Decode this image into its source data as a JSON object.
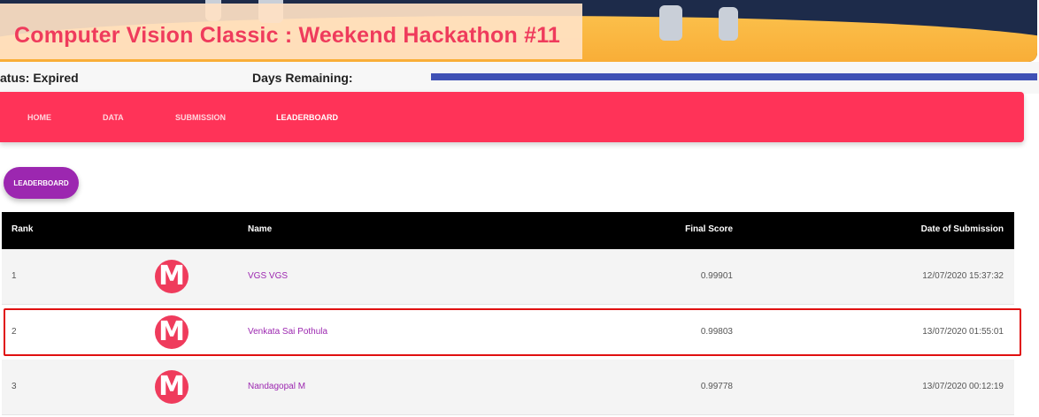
{
  "header": {
    "title": "Computer Vision Classic : Weekend Hackathon #11"
  },
  "status": {
    "status_text": "atus: Expired",
    "days_remaining_label": "Days Remaining:"
  },
  "nav": {
    "items": [
      {
        "label": "HOME"
      },
      {
        "label": "DATA"
      },
      {
        "label": "SUBMISSION"
      },
      {
        "label": "LEADERBOARD"
      }
    ],
    "active": "LEADERBOARD"
  },
  "leaderboard_button": "LEADERBOARD",
  "table": {
    "headers": {
      "rank": "Rank",
      "name": "Name",
      "score": "Final Score",
      "date": "Date of Submission"
    },
    "rows": [
      {
        "rank": "1",
        "avatar": "M",
        "name": "VGS VGS",
        "score": "0.99901",
        "date": "12/07/2020 15:37:32"
      },
      {
        "rank": "2",
        "avatar": "M",
        "name": "Venkata Sai Pothula",
        "score": "0.99803",
        "date": "13/07/2020 01:55:01"
      },
      {
        "rank": "3",
        "avatar": "M",
        "name": "Nandagopal M",
        "score": "0.99778",
        "date": "13/07/2020 00:12:19"
      }
    ]
  },
  "colors": {
    "accent": "#ff3358",
    "title": "#ef3b5c",
    "link": "#9c27b0",
    "progress": "#3f51b5",
    "highlight_border": "#e01010"
  }
}
